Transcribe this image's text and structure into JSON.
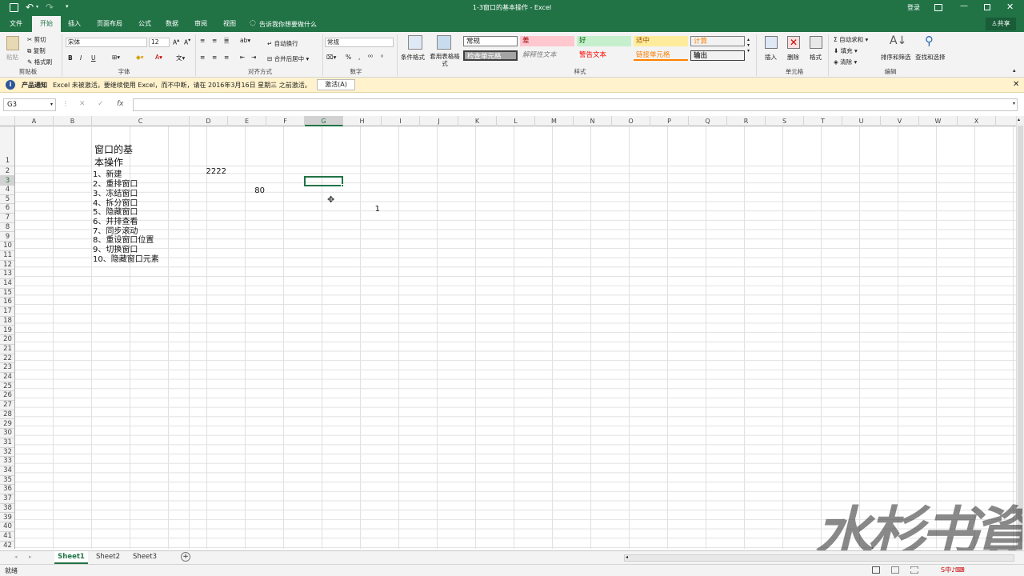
{
  "titlebar": {
    "title": "1-3窗口的基本操作 - Excel",
    "login": "登录",
    "share": "共享"
  },
  "tabs": [
    {
      "label": "文件"
    },
    {
      "label": "开始"
    },
    {
      "label": "插入"
    },
    {
      "label": "页面布局"
    },
    {
      "label": "公式"
    },
    {
      "label": "数据"
    },
    {
      "label": "审阅"
    },
    {
      "label": "视图"
    }
  ],
  "tell_me": "告诉我你想要做什么",
  "ribbon": {
    "clipboard": {
      "paste": "粘贴",
      "cut": "剪切",
      "copy": "复制",
      "format_painter": "格式刷",
      "label": "剪贴板"
    },
    "font": {
      "name": "宋体",
      "size": "12",
      "bold": "B",
      "italic": "I",
      "underline": "U",
      "label": "字体"
    },
    "alignment": {
      "wrap": "自动换行",
      "merge": "合并后居中",
      "label": "对齐方式"
    },
    "number": {
      "format": "常规",
      "percent": "%",
      "comma": ",",
      "label": "数字"
    },
    "styles": {
      "conditional": "条件格式",
      "table": "套用表格格式",
      "cells": [
        "常规",
        "差",
        "好",
        "适中",
        "计算",
        "检查单元格",
        "解释性文本",
        "警告文本",
        "链接单元格",
        "输出"
      ],
      "label": "样式"
    },
    "cells": {
      "insert": "插入",
      "delete": "删除",
      "format": "格式",
      "label": "单元格"
    },
    "editing": {
      "autosum": "自动求和",
      "fill": "填充",
      "clear": "清除",
      "sort": "排序和筛选",
      "find": "查找和选择",
      "label": "编辑"
    }
  },
  "infobar": {
    "title": "产品通知",
    "message": "Excel 未被激活。要继续使用 Excel，而不中断，请在 2016年3月16日 星期三 之前激活。",
    "button": "激活(A)"
  },
  "formula_bar": {
    "name_box": "G3",
    "fx": "fx",
    "value": ""
  },
  "columns": [
    "A",
    "B",
    "C",
    "D",
    "E",
    "F",
    "G",
    "H",
    "I",
    "J",
    "K",
    "L",
    "M",
    "N",
    "O",
    "P",
    "Q",
    "R",
    "S",
    "T",
    "U",
    "V",
    "W",
    "X"
  ],
  "selected_column": "G",
  "rows": [
    "1",
    "2",
    "3",
    "4",
    "5",
    "6",
    "7",
    "8",
    "9",
    "10",
    "11",
    "12",
    "13",
    "14",
    "15",
    "16",
    "17",
    "18",
    "19",
    "20",
    "21",
    "22",
    "23",
    "24",
    "25",
    "26",
    "27",
    "28",
    "29",
    "30",
    "31",
    "32",
    "33",
    "34",
    "35",
    "36",
    "37",
    "38",
    "39",
    "40",
    "41",
    "42"
  ],
  "selected_row": "3",
  "cells": {
    "C1a": "窗口的基",
    "C1b": "本操作",
    "C2": "1、新建",
    "C3": "2、重排窗口",
    "C4": "3、冻结窗口",
    "C5": "4、拆分窗口",
    "C6": "5、隐藏窗口",
    "C7": "6、并排查看",
    "C8": "7、同步滚动",
    "C9": "8、重设窗口位置",
    "C10": "9、切换窗口",
    "C11": "10、隐藏窗口元素",
    "D2": "2222",
    "E4": "80",
    "H6": "1"
  },
  "sheets": [
    "Sheet1",
    "Sheet2",
    "Sheet3"
  ],
  "active_sheet": "Sheet1",
  "status": {
    "mode": "就绪"
  },
  "watermark": "水杉书資",
  "colors": {
    "brand": "#217346",
    "info": "#fff2cc",
    "grid": "#e1e1e1"
  }
}
